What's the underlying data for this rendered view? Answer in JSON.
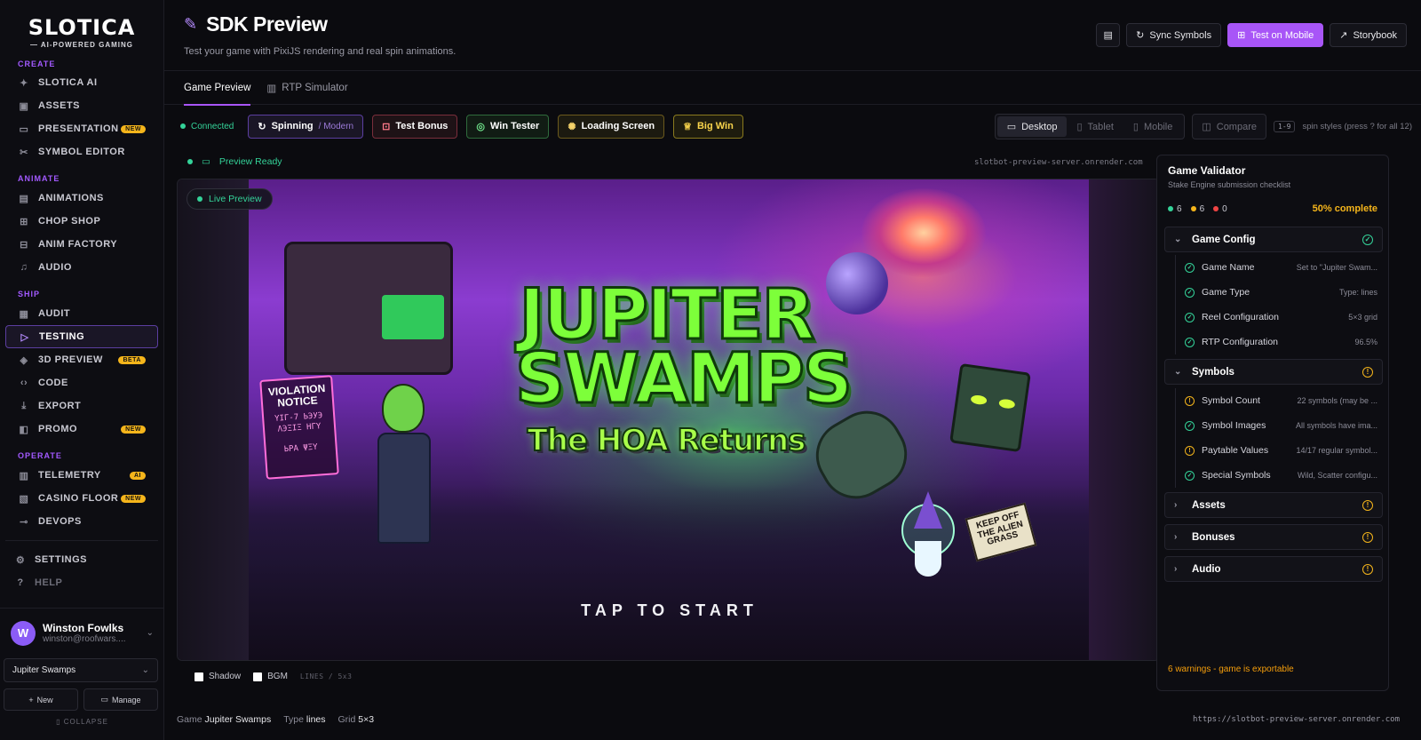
{
  "sidebar": {
    "logo": "SLOTICA",
    "tagline": "— AI-POWERED GAMING",
    "sections": {
      "create": "CREATE",
      "animate": "ANIMATE",
      "ship": "SHIP",
      "operate": "OPERATE"
    },
    "create_items": [
      {
        "label": "SLOTICA AI"
      },
      {
        "label": "ASSETS"
      },
      {
        "label": "PRESENTATION",
        "badge": "NEW"
      },
      {
        "label": "SYMBOL EDITOR"
      }
    ],
    "animate_items": [
      {
        "label": "ANIMATIONS"
      },
      {
        "label": "CHOP SHOP"
      },
      {
        "label": "ANIM FACTORY"
      },
      {
        "label": "AUDIO"
      }
    ],
    "ship_items": [
      {
        "label": "AUDIT"
      },
      {
        "label": "TESTING"
      },
      {
        "label": "3D PREVIEW",
        "badge": "BETA"
      },
      {
        "label": "CODE"
      },
      {
        "label": "EXPORT"
      },
      {
        "label": "PROMO",
        "badge": "NEW"
      }
    ],
    "operate_items": [
      {
        "label": "TELEMETRY",
        "badge": "AI"
      },
      {
        "label": "CASINO FLOOR",
        "badge": "NEW"
      },
      {
        "label": "DEVOPS"
      }
    ],
    "settings": "SETTINGS",
    "help": "HELP",
    "user": {
      "initial": "W",
      "name": "Winston Fowlks",
      "email": "winston@roofwars...."
    },
    "project": "Jupiter Swamps",
    "new_label": "New",
    "manage_label": "Manage",
    "collapse": "COLLAPSE"
  },
  "header": {
    "title": "SDK Preview",
    "subtitle": "Test your game with PixiJS rendering and real spin animations.",
    "sync": "Sync Symbols",
    "mobile": "Test on Mobile",
    "storybook": "Storybook"
  },
  "tabs": [
    "Game Preview",
    "RTP Simulator"
  ],
  "toolbar": {
    "connected": "Connected",
    "spinning": "Spinning",
    "modern": "/ Modern",
    "bonus": "Test Bonus",
    "win": "Win Tester",
    "loading": "Loading Screen",
    "bigwin": "Big Win",
    "devices": [
      "Desktop",
      "Tablet",
      "Mobile"
    ],
    "compare": "Compare",
    "kbd": "1-9",
    "hint": "spin styles (press ? for all 12)"
  },
  "preview": {
    "status": "Preview Ready",
    "server": "slotbot-preview-server.onrender.com",
    "live": "Live Preview",
    "game_title_1": "JUPITER",
    "game_title_2": "SWAMPS",
    "game_subtitle": "The HOA Returns",
    "tap": "TAP TO START",
    "sign_title": "VIOLATION NOTICE",
    "sign_body": "ΥΙΓ-7 ЬЭУЭ\nΛЭΞΙΞ ΗΓΥ\n\nЬΡΑ ΨΞΥ",
    "grass_sign": "KEEP OFF THE ALIEN GRASS"
  },
  "options": {
    "shadow": "Shadow",
    "bgm": "BGM",
    "mode": "LINES / 5x3"
  },
  "footer": {
    "game_label": "Game",
    "game_value": "Jupiter Swamps",
    "type_label": "Type",
    "type_value": "lines",
    "grid_label": "Grid",
    "grid_value": "5×3",
    "url": "https://slotbot-preview-server.onrender.com"
  },
  "validator": {
    "title": "Game Validator",
    "subtitle": "Stake Engine submission checklist",
    "pass_count": "6",
    "warn_count": "6",
    "fail_count": "0",
    "percent": "50% complete",
    "sections": {
      "config": "Game Config",
      "symbols": "Symbols",
      "assets": "Assets",
      "bonuses": "Bonuses",
      "audio": "Audio"
    },
    "config_items": [
      {
        "name": "Game Name",
        "value": "Set to \"Jupiter Swam..."
      },
      {
        "name": "Game Type",
        "value": "Type: lines"
      },
      {
        "name": "Reel Configuration",
        "value": "5×3 grid"
      },
      {
        "name": "RTP Configuration",
        "value": "96.5%"
      }
    ],
    "symbol_items": [
      {
        "name": "Symbol Count",
        "value": "22 symbols (may be ..."
      },
      {
        "name": "Symbol Images",
        "value": "All symbols have ima..."
      },
      {
        "name": "Paytable Values",
        "value": "14/17 regular symbol..."
      },
      {
        "name": "Special Symbols",
        "value": "Wild, Scatter configu..."
      }
    ],
    "footer": "6 warnings - game is exportable"
  },
  "colors": {
    "accent": "#a855f7",
    "ok": "#34d399",
    "warn": "#f5b51b",
    "error": "#ef4444"
  }
}
